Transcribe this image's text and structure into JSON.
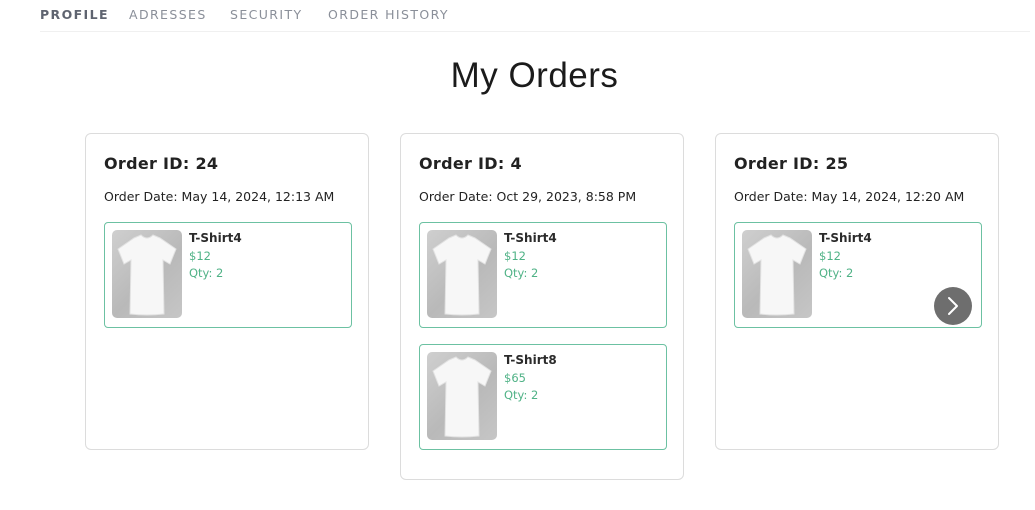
{
  "tabs": [
    {
      "label": "PROFILE",
      "active": true
    },
    {
      "label": "ADRESSES",
      "active": false
    },
    {
      "label": "SECURITY",
      "active": false
    },
    {
      "label": "ORDER HISTORY",
      "active": false
    }
  ],
  "page_title": "My Orders",
  "orders": [
    {
      "id_label": "Order ID: 24",
      "date_label": "Order Date: May 14, 2024, 12:13 AM",
      "items": [
        {
          "name": "T-Shirt4",
          "price": "$12",
          "qty": "Qty: 2",
          "image_icon": "tshirt-icon"
        }
      ]
    },
    {
      "id_label": "Order ID: 4",
      "date_label": "Order Date: Oct 29, 2023, 8:58 PM",
      "items": [
        {
          "name": "T-Shirt4",
          "price": "$12",
          "qty": "Qty: 2",
          "image_icon": "tshirt-icon"
        },
        {
          "name": "T-Shirt8",
          "price": "$65",
          "qty": "Qty: 2",
          "image_icon": "tshirt-icon"
        }
      ]
    },
    {
      "id_label": "Order ID: 25",
      "date_label": "Order Date: May 14, 2024, 12:20 AM",
      "items": [
        {
          "name": "T-Shirt4",
          "price": "$12",
          "qty": "Qty: 2",
          "image_icon": "tshirt-icon"
        }
      ]
    }
  ],
  "carousel": {
    "next_icon": "chevron-right-icon"
  },
  "colors": {
    "accent_green": "#4fb286",
    "item_border": "#6cc1a2",
    "tab_text": "#8a8f99",
    "next_button_bg": "#6e6e6e"
  }
}
